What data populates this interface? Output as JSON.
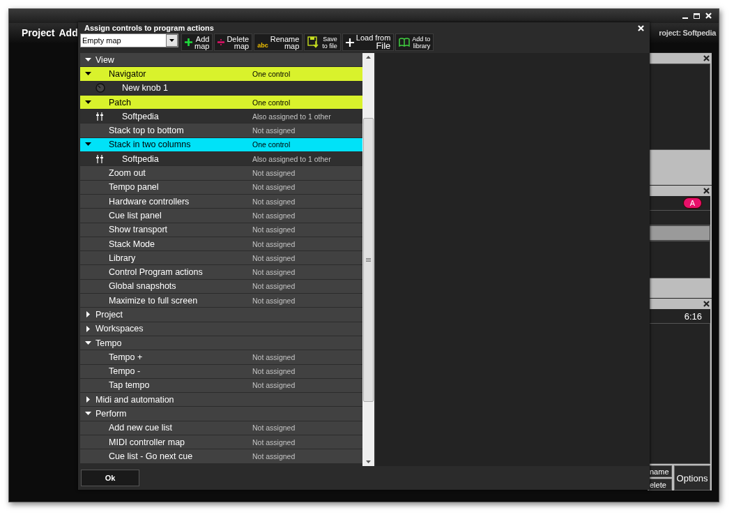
{
  "app": {
    "menu": [
      "Project",
      "Add"
    ],
    "project_label": "roject: Softpedia",
    "panels": [
      {
        "kind": "empty"
      },
      {
        "kind": "badge",
        "badge": "A",
        "color": "#e8106a"
      },
      {
        "kind": "time",
        "time": "6:16"
      }
    ],
    "stacked_buttons": [
      "name",
      "elete"
    ],
    "options_button": "Options"
  },
  "dialog": {
    "title": "Assign controls to program actions",
    "map_select": {
      "value": "Empty map"
    },
    "toolbar": [
      {
        "kind": "add",
        "lines": [
          "Add",
          "map"
        ]
      },
      {
        "kind": "delete",
        "lines": [
          "Delete",
          "map"
        ]
      },
      {
        "kind": "rename",
        "tag": "abc",
        "lines": [
          "Rename",
          "map"
        ]
      },
      {
        "kind": "save",
        "lines": [
          "Save",
          "to file"
        ]
      },
      {
        "kind": "load",
        "lines": [
          "Load from",
          "File"
        ]
      },
      {
        "kind": "library",
        "lines": [
          "Add to",
          "library"
        ]
      }
    ],
    "tree": [
      {
        "label": "View",
        "expanded": true,
        "children": [
          {
            "label": "Navigator",
            "status": "One control",
            "expanded": true,
            "color": "#d9f22c",
            "children": [
              {
                "label": "New knob 1",
                "kind": "knob"
              }
            ]
          },
          {
            "label": "Patch",
            "status": "One control",
            "expanded": true,
            "color": "#d9f22c",
            "children": [
              {
                "label": "Softpedia",
                "kind": "fader",
                "status": "Also assigned to 1 other"
              }
            ]
          },
          {
            "label": "Stack top to bottom",
            "status": "Not assigned"
          },
          {
            "label": "Stack in two columns",
            "status": "One control",
            "expanded": true,
            "color": "#00e2f8",
            "children": [
              {
                "label": "Softpedia",
                "kind": "fader",
                "status": "Also assigned to 1 other"
              }
            ]
          },
          {
            "label": "Zoom out",
            "status": "Not assigned"
          },
          {
            "label": "Tempo panel",
            "status": "Not assigned"
          },
          {
            "label": "Hardware controllers",
            "status": "Not assigned"
          },
          {
            "label": "Cue list panel",
            "status": "Not assigned"
          },
          {
            "label": "Show transport",
            "status": "Not assigned"
          },
          {
            "label": "Stack Mode",
            "status": "Not assigned"
          },
          {
            "label": "Library",
            "status": "Not assigned"
          },
          {
            "label": "Control Program actions",
            "status": "Not assigned"
          },
          {
            "label": "Global snapshots",
            "status": "Not assigned"
          },
          {
            "label": "Maximize to full screen",
            "status": "Not assigned"
          }
        ]
      },
      {
        "label": "Project",
        "expanded": false
      },
      {
        "label": "Workspaces",
        "expanded": false
      },
      {
        "label": "Tempo",
        "expanded": true,
        "children": [
          {
            "label": "Tempo +",
            "status": "Not assigned"
          },
          {
            "label": "Tempo -",
            "status": "Not assigned"
          },
          {
            "label": "Tap tempo",
            "status": "Not assigned"
          }
        ]
      },
      {
        "label": "Midi and automation",
        "expanded": false
      },
      {
        "label": "Perform",
        "expanded": true,
        "children": [
          {
            "label": "Add new cue list",
            "status": "Not assigned"
          },
          {
            "label": "MIDI controller map",
            "status": "Not assigned"
          },
          {
            "label": "Cue list - Go next cue",
            "status": "Not assigned"
          }
        ]
      }
    ],
    "ok_button": "Ok"
  }
}
